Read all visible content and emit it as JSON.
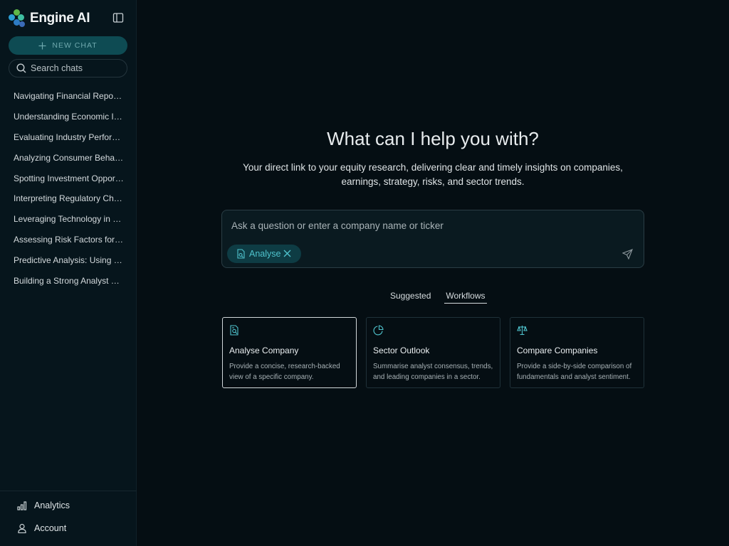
{
  "brand": {
    "name": "Engine AI"
  },
  "sidebar": {
    "new_chat_label": "NEW CHAT",
    "search_placeholder": "Search chats",
    "chats": [
      "Navigating Financial Reports: A Beginner's Guide",
      "Understanding Economic Indicators",
      "Evaluating Industry Performance",
      "Analyzing Consumer Behavior Trends",
      "Spotting Investment Opportunities",
      "Interpreting Regulatory Changes",
      "Leveraging Technology in Market Research",
      "Assessing Risk Factors for Equities",
      "Predictive Analysis: Using Data Models",
      "Building a Strong Analyst Portfolio"
    ],
    "bottom": {
      "analytics_label": "Analytics",
      "account_label": "Account"
    }
  },
  "main": {
    "title": "What can I help you with?",
    "subtitle": "Your direct link to your equity research, delivering clear and timely insights on companies, earnings, strategy, risks, and sector trends.",
    "prompt_placeholder": "Ask a question or enter a company name or ticker",
    "chip_label": "Analyse",
    "tabs": [
      "Suggested",
      "Workflows"
    ],
    "active_tab": "Workflows",
    "cards": [
      {
        "title": "Analyse Company",
        "desc": "Provide a concise, research-backed view of a specific company.",
        "icon": "document-search-icon"
      },
      {
        "title": "Sector Outlook",
        "desc": "Summarise analyst consensus, trends, and leading companies in a sector.",
        "icon": "pie-chart-icon"
      },
      {
        "title": "Compare Companies",
        "desc": "Provide a side-by-side comparison of fundamentals and analyst sentiment.",
        "icon": "scale-icon"
      }
    ]
  },
  "colors": {
    "accent": "#4fc3cd",
    "background": "#050e13",
    "sidebar": "#06151c",
    "new_chat_bg": "#0e4b53"
  }
}
